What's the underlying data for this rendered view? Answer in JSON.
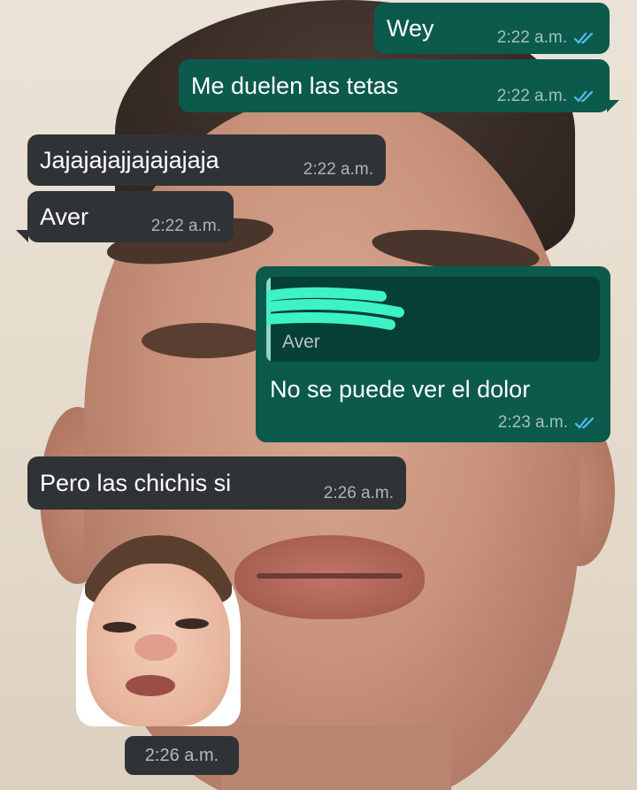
{
  "messages": [
    {
      "direction": "out",
      "text": "Wey",
      "time": "2:22 a.m.",
      "read": true
    },
    {
      "direction": "out",
      "text": "Me duelen las tetas",
      "time": "2:22 a.m.",
      "read": true
    },
    {
      "direction": "in",
      "text": "Jajajajajjajajajaja",
      "time": "2:22 a.m."
    },
    {
      "direction": "in",
      "text": "Aver",
      "time": "2:22 a.m."
    },
    {
      "direction": "out",
      "quoted_text": "Aver",
      "text": "No se puede ver el dolor",
      "time": "2:23 a.m.",
      "read": true
    },
    {
      "direction": "in",
      "text": "Pero las chichis si",
      "time": "2:26 a.m."
    },
    {
      "direction": "in",
      "type": "sticker",
      "time": "2:26 a.m."
    }
  ],
  "colors": {
    "outgoing_bubble": "#0b5a4c",
    "incoming_bubble": "#2f3336",
    "read_ticks": "#53bdeb",
    "quote_redaction": "#3df2c4"
  },
  "icons": {
    "read_receipt": "double-check-icon"
  }
}
